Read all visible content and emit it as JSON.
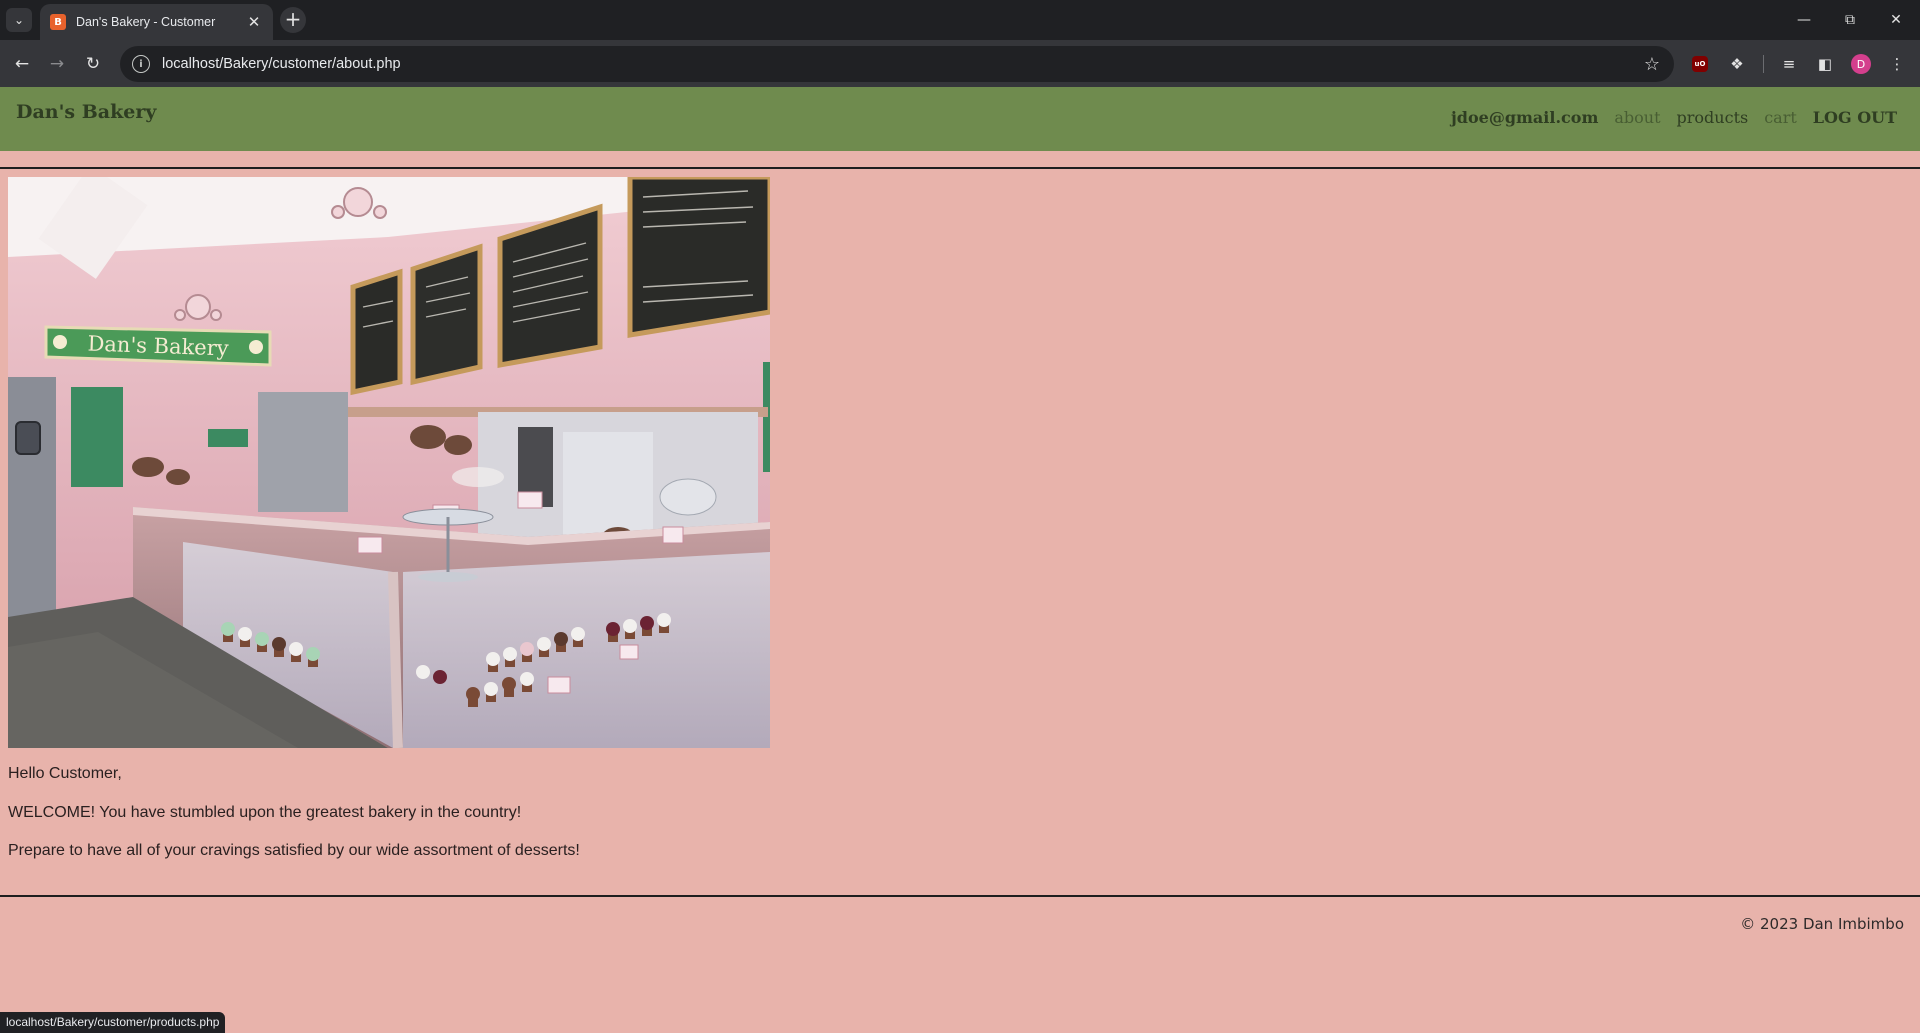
{
  "browser": {
    "tab_title": "Dan's Bakery - Customer",
    "url": "localhost/Bakery/customer/about.php",
    "profile_initial": "D",
    "status_url": "localhost/Bakery/customer/products.php"
  },
  "header": {
    "brand": "Dan's Bakery",
    "user_email": "jdoe@gmail.com",
    "nav": {
      "about": "about",
      "products": "products",
      "cart": "cart",
      "logout": "LOG OUT"
    }
  },
  "main": {
    "image_alt": "Interior of Dan's Bakery",
    "greeting": "Hello Customer,",
    "welcome": "WELCOME! You have stumbled upon the greatest bakery in the country!",
    "tagline": "Prepare to have all of your cravings satisfied by our wide assortment of desserts!"
  },
  "photo": {
    "sign_text": "Dan's Bakery"
  },
  "footer": {
    "copyright": "© 2023 Dan Imbimbo"
  },
  "colors": {
    "page_bg": "#e8b3ab",
    "header_bg": "#6f8b4e",
    "brand_text": "#2f3e22"
  }
}
